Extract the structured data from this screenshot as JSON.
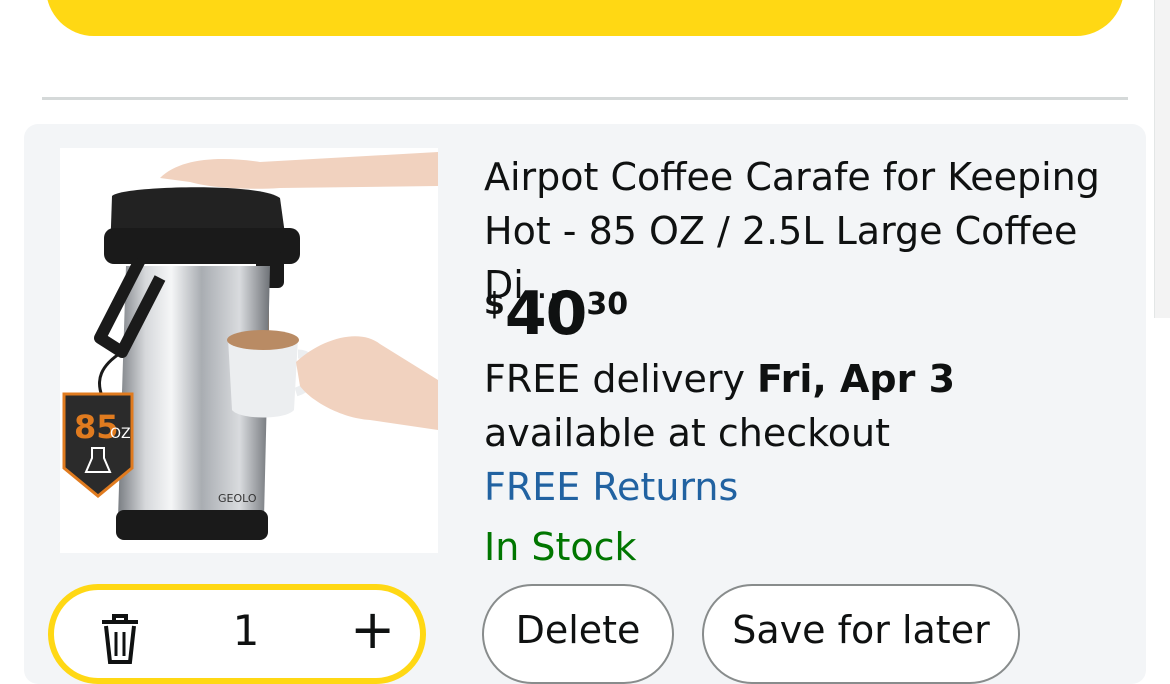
{
  "product": {
    "title": "Airpot Coffee Carafe for Keeping Hot - 85 OZ / 2.5L Large Coffee Di...",
    "price": {
      "currency": "$",
      "whole": "40",
      "fraction": "30"
    },
    "delivery": {
      "prefix": "FREE delivery ",
      "date": "Fri, Apr 3",
      "suffix": " available at checkout"
    },
    "returns": "FREE Returns",
    "stock": "In Stock",
    "badge": {
      "size": "85",
      "unit": "OZ"
    },
    "brand_mark": "GEOLO"
  },
  "quantity": {
    "value": "1",
    "plus_label": "+"
  },
  "actions": {
    "delete_label": "Delete",
    "save_label": "Save for later"
  },
  "colors": {
    "yellow": "#ffd814",
    "link": "#2162a1",
    "stock": "#007600"
  }
}
